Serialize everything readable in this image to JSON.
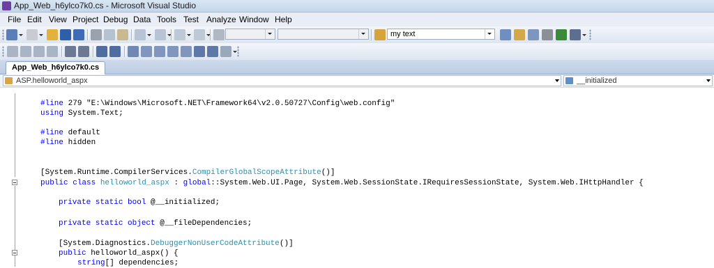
{
  "window": {
    "title": "App_Web_h6ylco7k0.cs - Microsoft Visual Studio"
  },
  "menu": [
    "File",
    "Edit",
    "View",
    "Project",
    "Debug",
    "Data",
    "Tools",
    "Test",
    "Analyze",
    "Window",
    "Help"
  ],
  "toolbar": {
    "solution_config": "",
    "solution_platform": "",
    "find_combo_value": "my text"
  },
  "document_tab": {
    "label": "App_Web_h6ylco7k0.cs"
  },
  "navigation": {
    "types_combo": "ASP.helloworld_aspx",
    "members_combo": "__initialized"
  },
  "code": {
    "line1_directive": "#line",
    "line1_rest": " 279 \"E:\\Windows\\Microsoft.NET\\Framework64\\v2.0.50727\\Config\\web.config\"",
    "line2_kw": "using",
    "line2_rest": " System.Text;",
    "line3_directive": "#line",
    "line3_rest": " default",
    "line4_directive": "#line",
    "line4_rest": " hidden",
    "line5_pre": "[System.Runtime.CompilerServices.",
    "line5_type": "CompilerGlobalScopeAttribute",
    "line5_post": "()]",
    "line6_kw": "public class",
    "line6_sp": " ",
    "line6_type": "helloworld_aspx",
    "line6_mid": " : ",
    "line6_kw2": "global",
    "line6_rest": "::System.Web.UI.Page, System.Web.SessionState.IRequiresSessionState, System.Web.IHttpHandler {",
    "line7_kw": "private static bool",
    "line7_rest": " @__initialized;",
    "line8_kw": "private static object",
    "line8_rest": " @__fileDependencies;",
    "line9_pre": "[System.Diagnostics.",
    "line9_type": "DebuggerNonUserCodeAttribute",
    "line9_post": "()]",
    "line10_kw": "public",
    "line10_rest": " helloworld_aspx() {",
    "line11_kw": "string",
    "line11_rest": "[] dependencies;"
  },
  "colors": {
    "keyword": "#0000ff",
    "type": "#2b91af",
    "text": "#000000",
    "chrome": "#dde5f0"
  },
  "icons": [
    "vs-app-icon",
    "new-project-icon",
    "add-item-icon",
    "open-file-icon",
    "save-icon",
    "save-all-icon",
    "cut-icon",
    "copy-icon",
    "paste-icon",
    "undo-icon",
    "redo-icon",
    "navigate-backward-icon",
    "navigate-forward-icon",
    "start-debugging-icon",
    "find-in-files-icon",
    "solution-explorer-icon",
    "properties-icon",
    "object-browser-icon",
    "toolbox-icon",
    "start-page-icon",
    "command-window-icon",
    "class-icon",
    "field-icon",
    "outline-collapse-icon"
  ]
}
